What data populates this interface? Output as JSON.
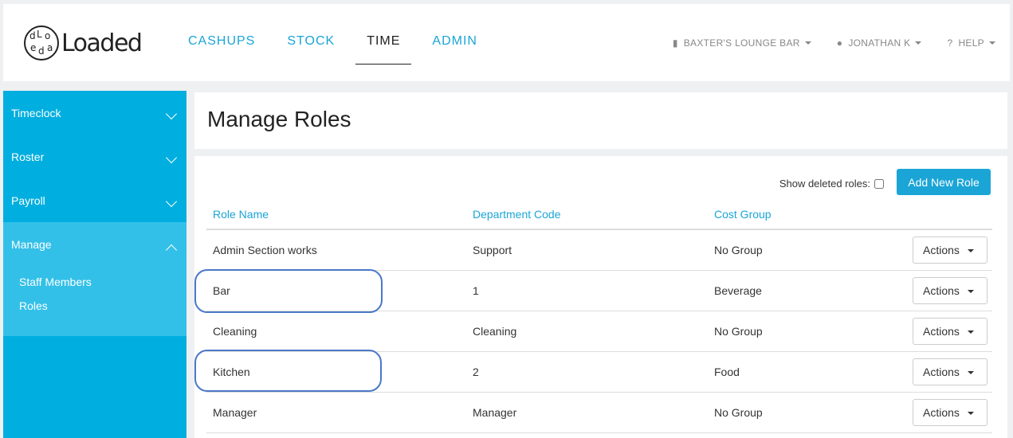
{
  "app": {
    "logo_text": "Loaded",
    "logo_letters": [
      "d",
      "L",
      "o",
      "e",
      "d",
      "a"
    ]
  },
  "nav": {
    "items": [
      {
        "label": "CASHUPS",
        "active": false
      },
      {
        "label": "STOCK",
        "active": false
      },
      {
        "label": "TIME",
        "active": true
      },
      {
        "label": "ADMIN",
        "active": false
      }
    ]
  },
  "top_right": {
    "venue": "BAXTER'S LOUNGE BAR",
    "user": "JONATHAN K",
    "help": "HELP"
  },
  "sidebar": {
    "items": [
      {
        "label": "Timeclock",
        "open": false
      },
      {
        "label": "Roster",
        "open": false
      },
      {
        "label": "Payroll",
        "open": false
      },
      {
        "label": "Manage",
        "open": true
      }
    ],
    "sub_items": [
      "Staff Members",
      "Roles"
    ]
  },
  "page": {
    "title": "Manage Roles",
    "show_deleted_label": "Show deleted roles:",
    "add_button": "Add New Role"
  },
  "table": {
    "columns": [
      "Role Name",
      "Department Code",
      "Cost Group"
    ],
    "rows": [
      {
        "name": "Admin Section works",
        "department": "Support",
        "cost_group": "No Group",
        "action": "Actions"
      },
      {
        "name": "Bar",
        "department": "1",
        "cost_group": "Beverage",
        "action": "Actions"
      },
      {
        "name": "Cleaning",
        "department": "Cleaning",
        "cost_group": "No Group",
        "action": "Actions"
      },
      {
        "name": "Kitchen",
        "department": "2",
        "cost_group": "Food",
        "action": "Actions"
      },
      {
        "name": "Manager",
        "department": "Manager",
        "cost_group": "No Group",
        "action": "Actions"
      }
    ]
  },
  "colors": {
    "accent": "#1ba5d6",
    "sidebar": "#00aee0",
    "highlight": "#4a78c8"
  }
}
